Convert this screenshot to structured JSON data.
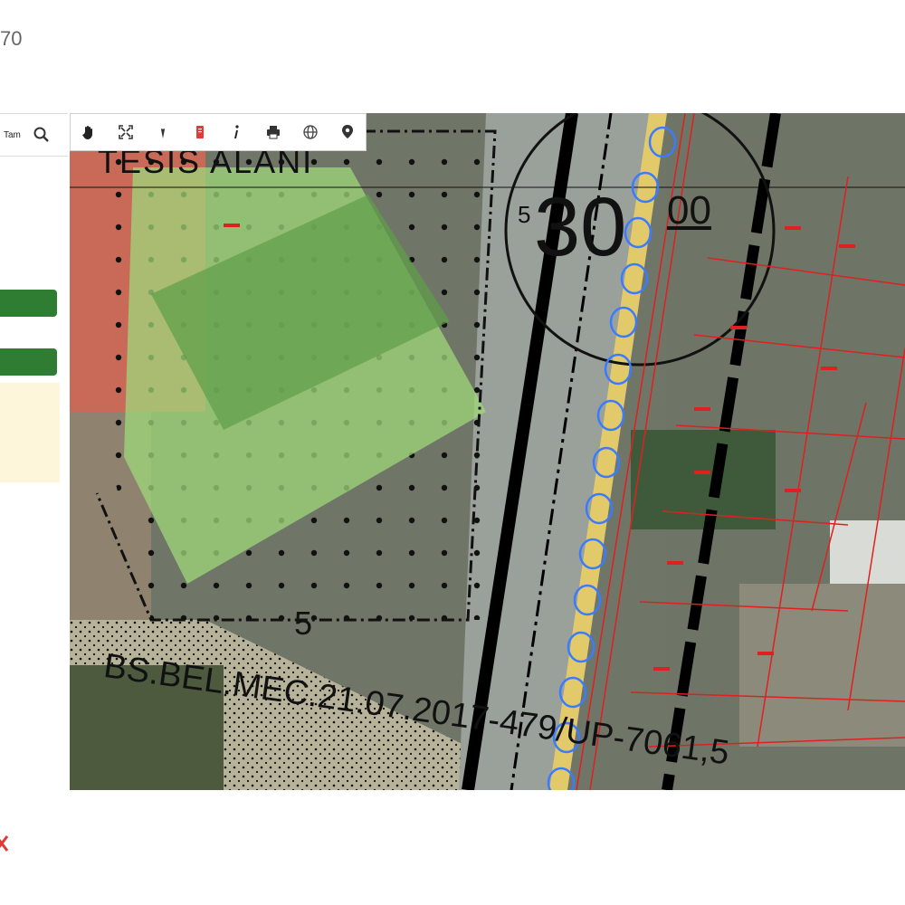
{
  "page": {
    "counter": "70"
  },
  "sidebar": {
    "search_label": "Tam",
    "search_icon": "search-icon",
    "close_icon": "close-icon",
    "close_color": "#e53935",
    "button_color": "#2e7d32",
    "panel_color": "#fdf6da"
  },
  "toolbar": {
    "tools": [
      {
        "icon": "pan-hand-icon"
      },
      {
        "icon": "full-extent-icon"
      },
      {
        "icon": "measure-icon"
      },
      {
        "icon": "document-icon"
      },
      {
        "icon": "info-icon"
      },
      {
        "icon": "print-icon"
      },
      {
        "icon": "globe-icon"
      },
      {
        "icon": "location-pin-icon"
      }
    ]
  },
  "map": {
    "area_label": "TESİS ALANI",
    "road_width": "30",
    "road_width_suffix": "00",
    "setback_top": "5",
    "setback_bottom": "5",
    "decision_label": "BS.BEL.MEC.21.07.2017-479/UP-7061,5",
    "parcel_color": "#e02020",
    "facility_fill": "#9fd87a",
    "road_marker_color": "#3a7bff"
  }
}
